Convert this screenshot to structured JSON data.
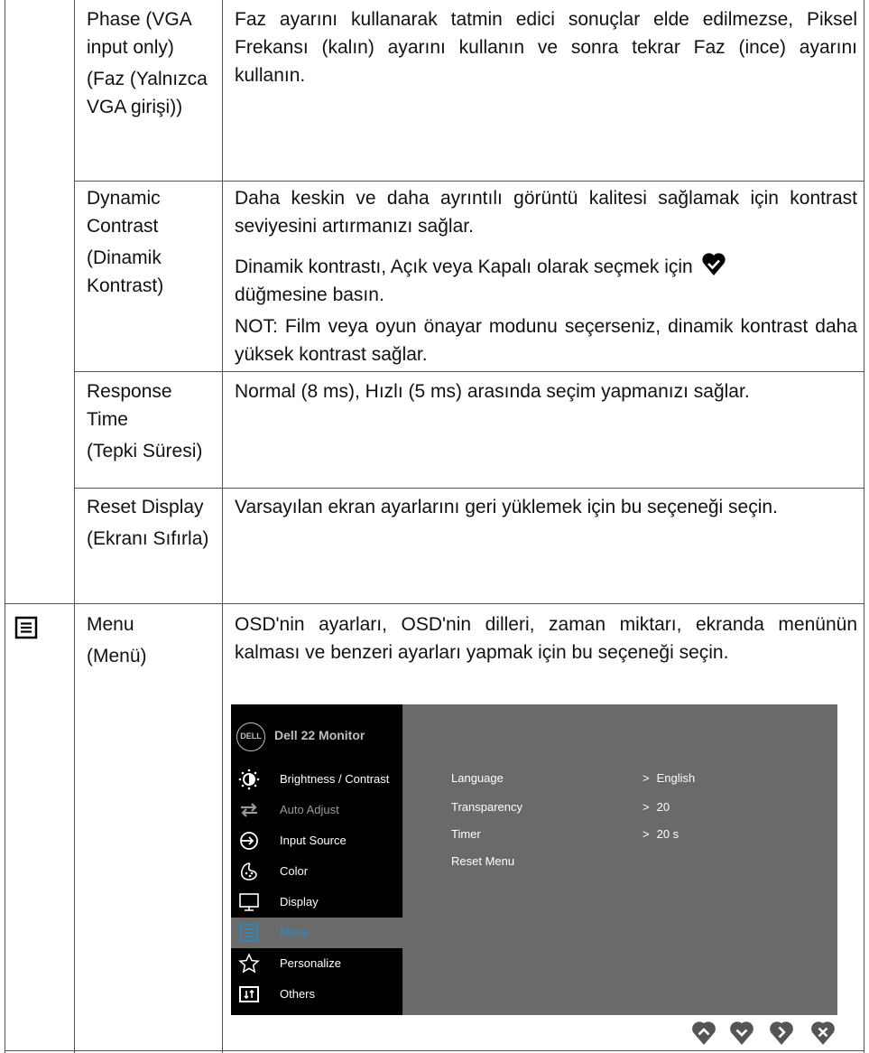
{
  "rows": [
    {
      "label_en": "Phase (VGA input only)",
      "label_tr": "(Faz (Yalnızca VGA girişi))",
      "desc": [
        "Faz ayarını kullanarak tatmin edici sonuçlar elde edilmezse, Piksel Frekansı (kalın) ayarını kullanın ve sonra tekrar Faz (ince) ayarını kullanın."
      ]
    },
    {
      "label_en": "Dynamic Contrast",
      "label_tr": "(Dinamik Kontrast)",
      "desc": [
        "Daha keskin ve daha ayrıntılı görüntü kalitesi sağlamak için kontrast seviyesini artırmanızı sağlar.",
        "Dinamik kontrastı, Açık veya Kapalı olarak seçmek için",
        "düğmesine basın.",
        "NOT: Film veya oyun önayar modunu seçerseniz, dinamik kontrast daha yüksek kontrast sağlar."
      ]
    },
    {
      "label_en": "Response Time",
      "label_tr": "(Tepki Süresi)",
      "desc": [
        "Normal (8 ms), Hızlı (5 ms) arasında seçim yapmanızı sağlar."
      ]
    },
    {
      "label_en": "Reset Display",
      "label_tr": "(Ekranı Sıfırla)",
      "desc": [
        "Varsayılan ekran ayarlarını geri yüklemek için bu seçeneği seçin."
      ]
    },
    {
      "label_en": "Menu",
      "label_tr": "(Menü)",
      "desc": [
        "OSD'nin ayarları, OSD'nin dilleri, zaman miktarı, ekranda menünün kalması ve benzeri ayarları yapmak için bu seçeneği seçin."
      ]
    }
  ],
  "osd": {
    "logo": "DELL",
    "title": "Dell 22 Monitor",
    "menu": [
      {
        "label": "Brightness / Contrast",
        "icon": "brightness-icon",
        "state": "normal"
      },
      {
        "label": "Auto Adjust",
        "icon": "auto-adjust-icon",
        "state": "dim"
      },
      {
        "label": "Input Source",
        "icon": "input-source-icon",
        "state": "normal"
      },
      {
        "label": "Color",
        "icon": "color-icon",
        "state": "normal"
      },
      {
        "label": "Display",
        "icon": "display-icon",
        "state": "normal"
      },
      {
        "label": "Menu",
        "icon": "menu-icon",
        "state": "active"
      },
      {
        "label": "Personalize",
        "icon": "star-icon",
        "state": "normal"
      },
      {
        "label": "Others",
        "icon": "others-icon",
        "state": "normal"
      }
    ],
    "settings": [
      {
        "label": "Language",
        "value": "English"
      },
      {
        "label": "Transparency",
        "value": "20"
      },
      {
        "label": "Timer",
        "value": "20 s"
      },
      {
        "label": "Reset Menu",
        "value": ""
      }
    ],
    "nav_buttons": [
      "up-button-icon",
      "down-button-icon",
      "right-button-icon",
      "close-button-icon"
    ],
    "colors": {
      "panel": "#6a6a6a",
      "sidebar": "#000000",
      "active_text": "#1e90d6",
      "dim_text": "#9a9a9a"
    }
  }
}
